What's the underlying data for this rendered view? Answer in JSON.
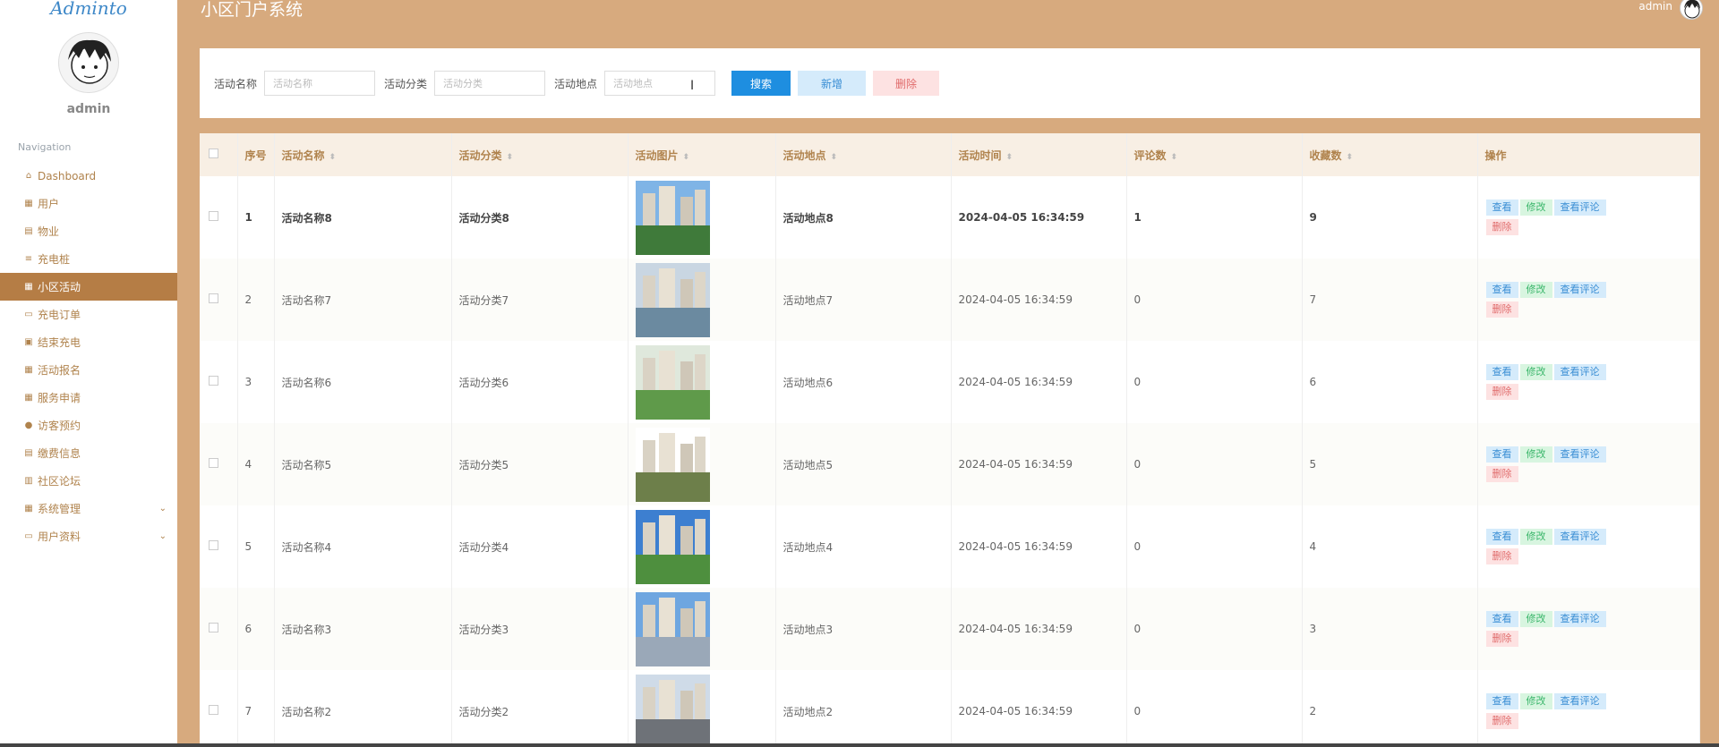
{
  "brand": "Adminto",
  "sidebar": {
    "user": "admin",
    "nav_title": "Navigation",
    "items": [
      {
        "label": "Dashboard",
        "icon": "⌂"
      },
      {
        "label": "用户",
        "icon": "▦"
      },
      {
        "label": "物业",
        "icon": "▤"
      },
      {
        "label": "充电桩",
        "icon": "≡"
      },
      {
        "label": "小区活动",
        "icon": "▦",
        "active": true
      },
      {
        "label": "充电订单",
        "icon": "▭"
      },
      {
        "label": "结束充电",
        "icon": "▣"
      },
      {
        "label": "活动报名",
        "icon": "▦"
      },
      {
        "label": "服务申请",
        "icon": "▦"
      },
      {
        "label": "访客预约",
        "icon": "●"
      },
      {
        "label": "缴费信息",
        "icon": "▤"
      },
      {
        "label": "社区论坛",
        "icon": "▥"
      },
      {
        "label": "系统管理",
        "icon": "▦",
        "expandable": true
      },
      {
        "label": "用户资料",
        "icon": "▭",
        "expandable": true
      }
    ]
  },
  "header": {
    "title": "小区门户系统",
    "user": "admin"
  },
  "search": {
    "name_label": "活动名称",
    "name_placeholder": "活动名称",
    "category_label": "活动分类",
    "category_placeholder": "活动分类",
    "location_label": "活动地点",
    "location_placeholder": "活动地点",
    "search_button": "搜索",
    "add_button": "新增",
    "delete_button": "删除"
  },
  "table": {
    "headers": {
      "index": "序号",
      "name": "活动名称",
      "category": "活动分类",
      "image": "活动图片",
      "location": "活动地点",
      "time": "活动时间",
      "comments": "评论数",
      "favorites": "收藏数",
      "actions": "操作"
    },
    "actions": {
      "view": "查看",
      "edit": "修改",
      "view_comments": "查看评论",
      "delete": "删除"
    },
    "rows": [
      {
        "index": "1",
        "name": "活动名称8",
        "category": "活动分类8",
        "location": "活动地点8",
        "time": "2024-04-05 16:34:59",
        "comments": "1",
        "favorites": "9",
        "sky": "#7fb4e6",
        "ground": "#3f7a3a"
      },
      {
        "index": "2",
        "name": "活动名称7",
        "category": "活动分类7",
        "location": "活动地点7",
        "time": "2024-04-05 16:34:59",
        "comments": "0",
        "favorites": "7",
        "sky": "#c9d6e2",
        "ground": "#6b8aa0"
      },
      {
        "index": "3",
        "name": "活动名称6",
        "category": "活动分类6",
        "location": "活动地点6",
        "time": "2024-04-05 16:34:59",
        "comments": "0",
        "favorites": "6",
        "sky": "#dfe8dc",
        "ground": "#5f9a4a"
      },
      {
        "index": "4",
        "name": "活动名称5",
        "category": "活动分类5",
        "location": "活动地点5",
        "time": "2024-04-05 16:34:59",
        "comments": "0",
        "favorites": "5",
        "sky": "#ffffff",
        "ground": "#6d7f4a"
      },
      {
        "index": "5",
        "name": "活动名称4",
        "category": "活动分类4",
        "location": "活动地点4",
        "time": "2024-04-05 16:34:59",
        "comments": "0",
        "favorites": "4",
        "sky": "#3d7fd0",
        "ground": "#4e8f3e"
      },
      {
        "index": "6",
        "name": "活动名称3",
        "category": "活动分类3",
        "location": "活动地点3",
        "time": "2024-04-05 16:34:59",
        "comments": "0",
        "favorites": "3",
        "sky": "#6ea6e0",
        "ground": "#9aa8b8"
      },
      {
        "index": "7",
        "name": "活动名称2",
        "category": "活动分类2",
        "location": "活动地点2",
        "time": "2024-04-05 16:34:59",
        "comments": "0",
        "favorites": "2",
        "sky": "#cfdbe8",
        "ground": "#6e7278"
      }
    ]
  }
}
